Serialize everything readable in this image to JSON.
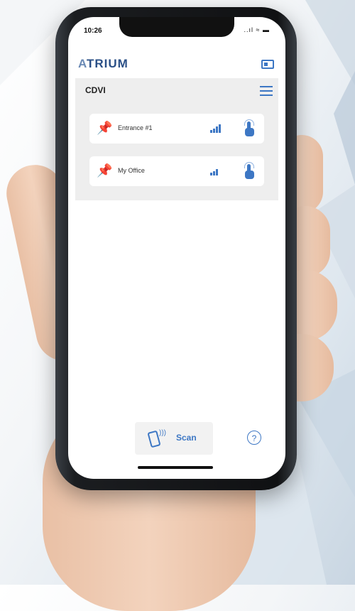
{
  "status_bar": {
    "time": "10:26",
    "icons": "..ıl ≈ ▬"
  },
  "header": {
    "logo_prefix": "A",
    "logo_rest": "TRIUM",
    "card_icon": "id-card-icon"
  },
  "site": {
    "title": "CDVI",
    "menu_icon": "list-icon"
  },
  "doors": [
    {
      "label": "Entrance #1",
      "icon": "pin-icon",
      "signal": "signal-strong",
      "action": "tap-icon"
    },
    {
      "label": "My Office",
      "icon": "pin-icon",
      "signal": "signal-medium",
      "action": "tap-icon"
    }
  ],
  "footer": {
    "scan_label": "Scan",
    "help_label": "?"
  },
  "colors": {
    "accent": "#3d77c4",
    "logo": "#2a4f86",
    "panel": "#eeeeee"
  }
}
